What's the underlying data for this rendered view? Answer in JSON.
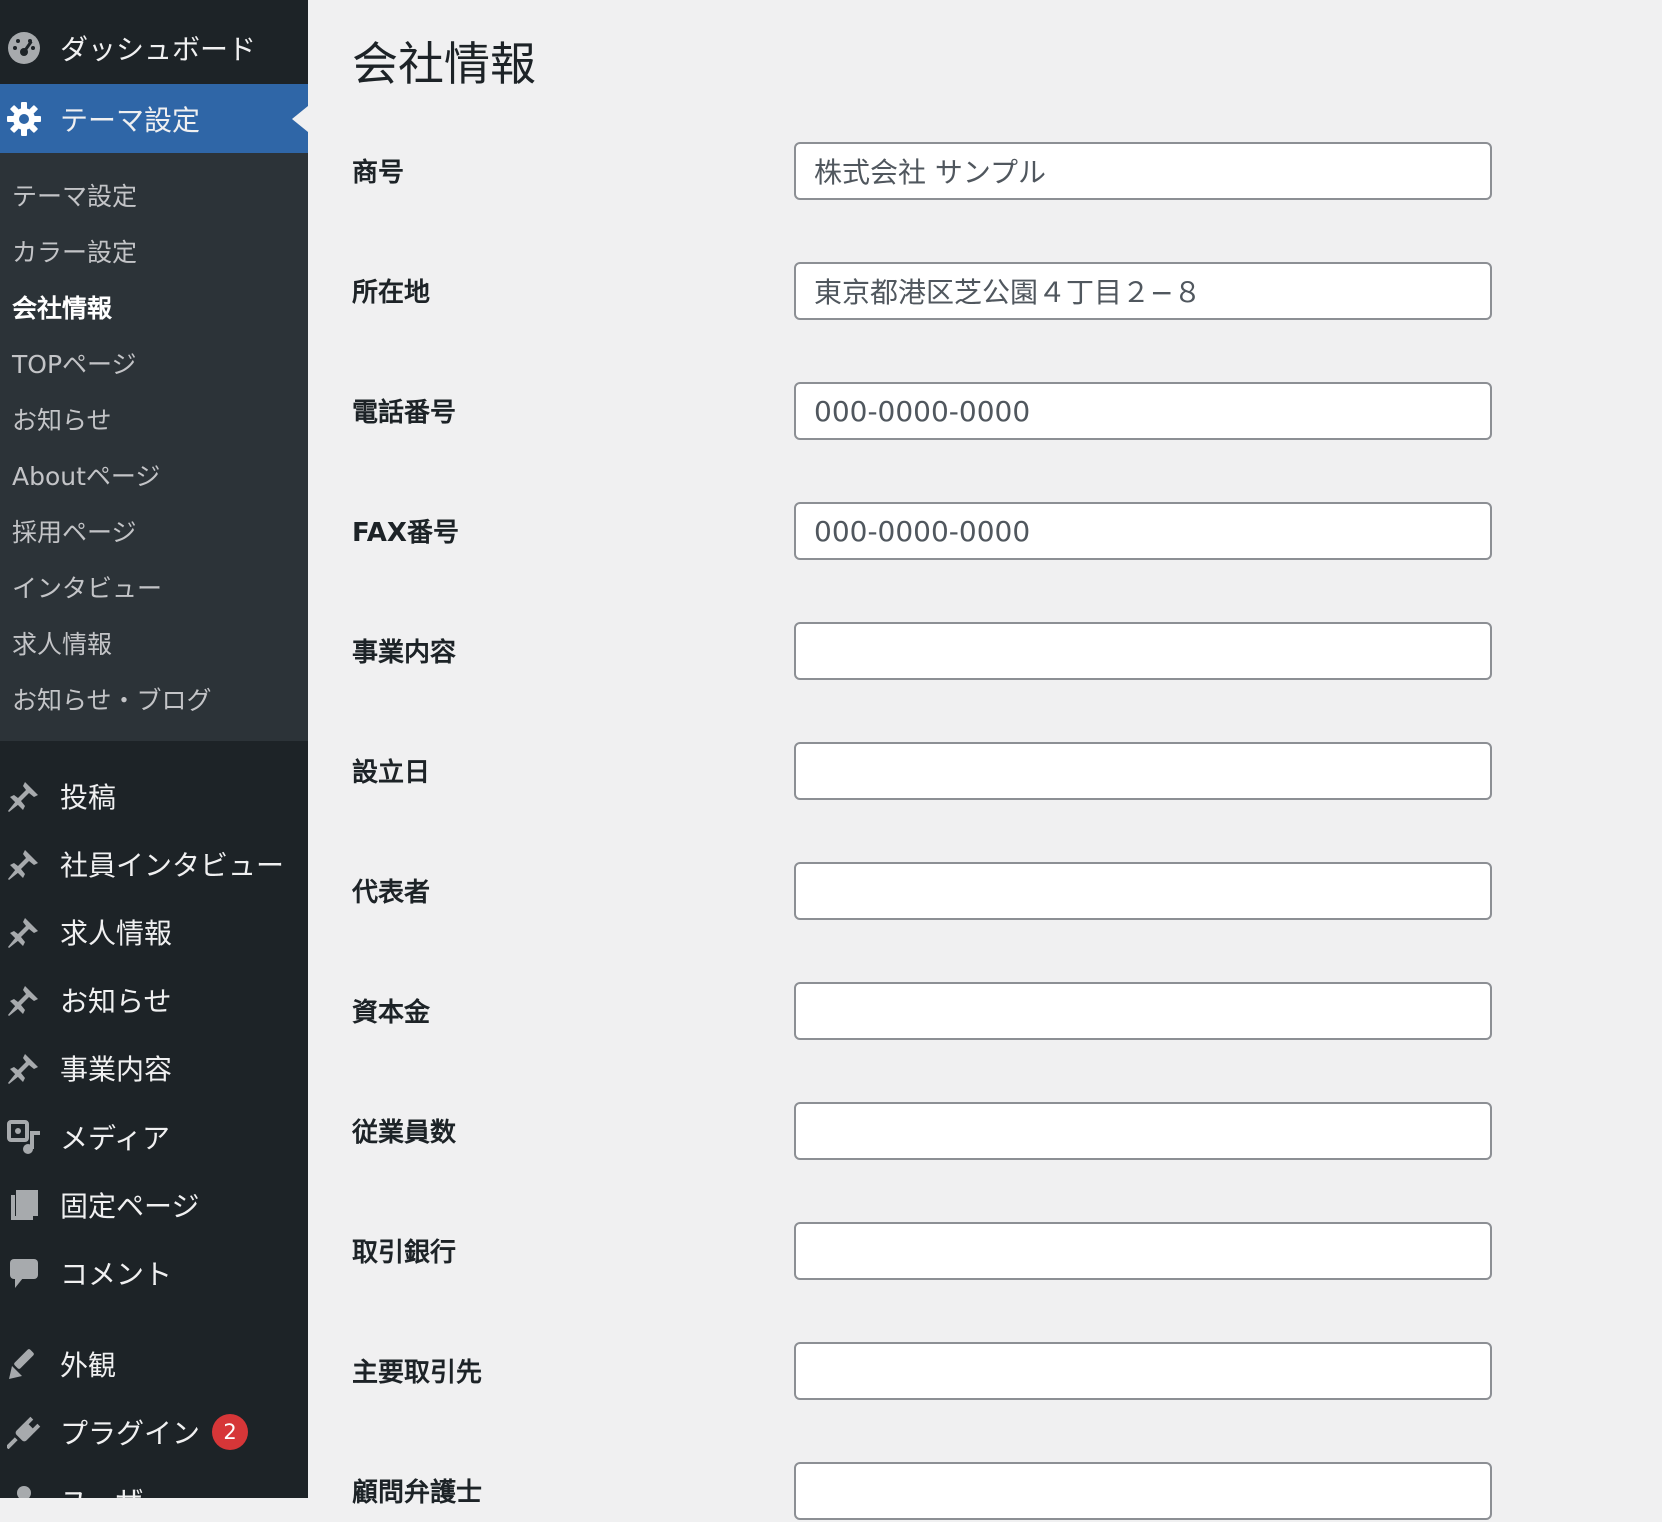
{
  "sidebar": {
    "dashboard": "ダッシュボード",
    "theme_settings": "テーマ設定",
    "submenu": [
      "テーマ設定",
      "カラー設定",
      "会社情報",
      "TOPページ",
      "お知らせ",
      "Aboutページ",
      "採用ページ",
      "インタビュー",
      "求人情報",
      "お知らせ・ブログ"
    ],
    "posts": "投稿",
    "employee_interview": "社員インタビュー",
    "job_info": "求人情報",
    "news": "お知らせ",
    "business": "事業内容",
    "media": "メディア",
    "pages": "固定ページ",
    "comments": "コメント",
    "appearance": "外観",
    "plugins": "プラグイン",
    "plugins_badge": "2",
    "users": "ユーザー"
  },
  "page_title": "会社情報",
  "fields": [
    {
      "label": "商号",
      "value": "株式会社 サンプル"
    },
    {
      "label": "所在地",
      "value": "東京都港区芝公園４丁目２−８"
    },
    {
      "label": "電話番号",
      "value": "000-0000-0000"
    },
    {
      "label": "FAX番号",
      "value": "000-0000-0000"
    },
    {
      "label": "事業内容",
      "value": ""
    },
    {
      "label": "設立日",
      "value": ""
    },
    {
      "label": "代表者",
      "value": ""
    },
    {
      "label": "資本金",
      "value": ""
    },
    {
      "label": "従業員数",
      "value": ""
    },
    {
      "label": "取引銀行",
      "value": ""
    },
    {
      "label": "主要取引先",
      "value": ""
    },
    {
      "label": "顧問弁護士",
      "value": ""
    }
  ],
  "colors": {
    "sidebar_bg": "#1d2327",
    "submenu_bg": "#2c3338",
    "active_bg": "#2f66a7",
    "badge": "#d63638",
    "page_bg": "#f0f0f1"
  },
  "icons": {
    "dashboard": "gauge-icon",
    "theme_settings": "gear-icon",
    "posts": "pushpin-icon",
    "media": "media-icon",
    "pages": "pages-icon",
    "comments": "comment-icon",
    "appearance": "brush-icon",
    "plugins": "plug-icon",
    "users": "user-icon"
  }
}
